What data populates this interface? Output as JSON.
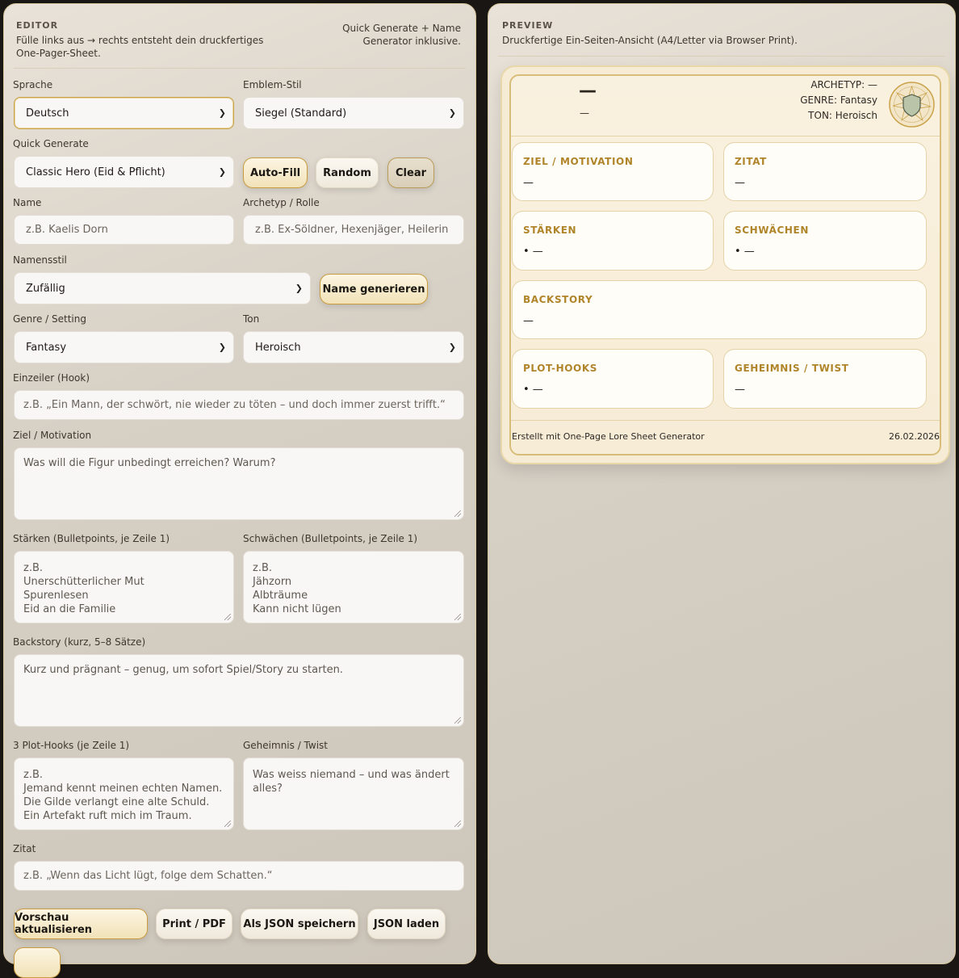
{
  "editor": {
    "title": "EDITOR",
    "subtitle": "Fülle links aus → rechts entsteht dein druckfertiges One-Pager-Sheet.",
    "note": "Quick Generate + Name Generator inklusive.",
    "language": {
      "label": "Sprache",
      "value": "Deutsch"
    },
    "emblem": {
      "label": "Emblem-Stil",
      "value": "Siegel (Standard)"
    },
    "quick_generate": {
      "label": "Quick Generate",
      "value": "Classic Hero (Eid & Pflicht)"
    },
    "buttons": {
      "autofill": "Auto-Fill",
      "random": "Random",
      "clear": "Clear",
      "name_generate": "Name generieren"
    },
    "name": {
      "label": "Name",
      "placeholder": "z.B. Kaelis Dorn"
    },
    "archetype": {
      "label": "Archetyp / Rolle",
      "placeholder": "z.B. Ex-Söldner, Hexenjäger, Heilerin"
    },
    "name_style": {
      "label": "Namensstil",
      "value": "Zufällig"
    },
    "genre": {
      "label": "Genre / Setting",
      "value": "Fantasy"
    },
    "tone": {
      "label": "Ton",
      "value": "Heroisch"
    },
    "hook": {
      "label": "Einzeiler (Hook)",
      "placeholder": "z.B. „Ein Mann, der schwört, nie wieder zu töten – und doch immer zuerst trifft.“"
    },
    "goal": {
      "label": "Ziel / Motivation",
      "placeholder": "Was will die Figur unbedingt erreichen? Warum?"
    },
    "strengths": {
      "label": "Stärken (Bulletpoints, je Zeile 1)",
      "placeholder": "z.B.\nUnerschütterlicher Mut\nSpurenlesen\nEid an die Familie"
    },
    "weaknesses": {
      "label": "Schwächen (Bulletpoints, je Zeile 1)",
      "placeholder": "z.B.\nJähzorn\nAlbträume\nKann nicht lügen"
    },
    "backstory": {
      "label": "Backstory (kurz, 5–8 Sätze)",
      "placeholder": "Kurz und prägnant – genug, um sofort Spiel/Story zu starten."
    },
    "plot_hooks": {
      "label": "3 Plot-Hooks (je Zeile 1)",
      "placeholder": "z.B.\nJemand kennt meinen echten Namen.\nDie Gilde verlangt eine alte Schuld.\nEin Artefakt ruft mich im Traum."
    },
    "secret": {
      "label": "Geheimnis / Twist",
      "placeholder": "Was weiss niemand – und was ändert alles?"
    },
    "quote": {
      "label": "Zitat",
      "placeholder": "z.B. „Wenn das Licht lügt, folge dem Schatten.“"
    },
    "actions": {
      "update": "Vorschau aktualisieren",
      "print": "Print / PDF",
      "save_json": "Als JSON speichern",
      "load_json": "JSON laden"
    }
  },
  "preview": {
    "title": "PREVIEW",
    "subtitle": "Druckfertige Ein-Seiten-Ansicht (A4/Letter via Browser Print).",
    "sheet": {
      "name": "—",
      "hook": "—",
      "archetype": "ARCHETYP: —",
      "genre": "GENRE: Fantasy",
      "tone": "TON: Heroisch",
      "cards": {
        "goal": {
          "title": "ZIEL / MOTIVATION",
          "value": "—"
        },
        "quote": {
          "title": "ZITAT",
          "value": "—"
        },
        "strengths": {
          "title": "STÄRKEN",
          "value": "•  —"
        },
        "weaknesses": {
          "title": "SCHWÄCHEN",
          "value": "•  —"
        },
        "backstory": {
          "title": "BACKSTORY",
          "value": "—"
        },
        "plot_hooks": {
          "title": "PLOT-HOOKS",
          "value": "•  —"
        },
        "secret": {
          "title": "GEHEIMNIS / TWIST",
          "value": "—"
        }
      },
      "footer_left": "Erstellt mit One-Page Lore Sheet Generator",
      "footer_right": "26.02.2026"
    }
  },
  "colors": {
    "accent": "#b0852a",
    "border_gold": "#c9a24a"
  }
}
